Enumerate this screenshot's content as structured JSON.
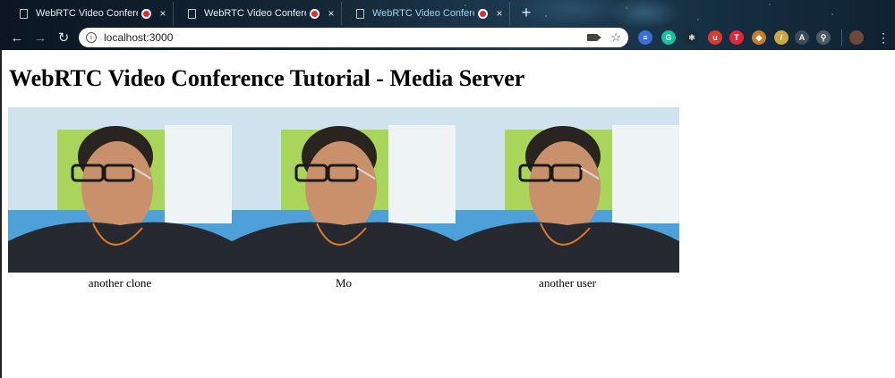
{
  "browser": {
    "tabs": [
      {
        "title": "WebRTC Video Conference",
        "recording": true,
        "active": false
      },
      {
        "title": "WebRTC Video Conference",
        "recording": true,
        "active": false
      },
      {
        "title": "WebRTC Video Conference",
        "recording": true,
        "active": true
      }
    ],
    "new_tab_label": "+",
    "close_glyph": "×",
    "address": "localhost:3000",
    "info_glyph": "i",
    "star_glyph": "☆",
    "menu_glyph": "⋮",
    "back_glyph": "←",
    "forward_glyph": "→",
    "reload_glyph": "↻"
  },
  "extensions": [
    {
      "name": "stack-icon",
      "color": "#3a6fd8",
      "glyph": "≡"
    },
    {
      "name": "grammarly-icon",
      "color": "#15c39a",
      "glyph": "G"
    },
    {
      "name": "react-devtools-icon",
      "color": "#1b2b3a",
      "glyph": "⚛"
    },
    {
      "name": "ublock-icon",
      "color": "#d93a2b",
      "glyph": "u"
    },
    {
      "name": "todoist-icon",
      "color": "#e0283b",
      "glyph": "T"
    },
    {
      "name": "extension-icon",
      "color": "#c77b30",
      "glyph": "◆"
    },
    {
      "name": "eyedropper-icon",
      "color": "#c8a845",
      "glyph": "/"
    },
    {
      "name": "disabled-extension-icon",
      "color": "#3b4b58",
      "glyph": "A"
    },
    {
      "name": "search-extension-icon",
      "color": "#4a5a66",
      "glyph": "⚲"
    }
  ],
  "page": {
    "title": "WebRTC Video Conference Tutorial - Media Server",
    "videos": [
      {
        "caption": "another clone"
      },
      {
        "caption": "Mo"
      },
      {
        "caption": "another user"
      }
    ]
  }
}
